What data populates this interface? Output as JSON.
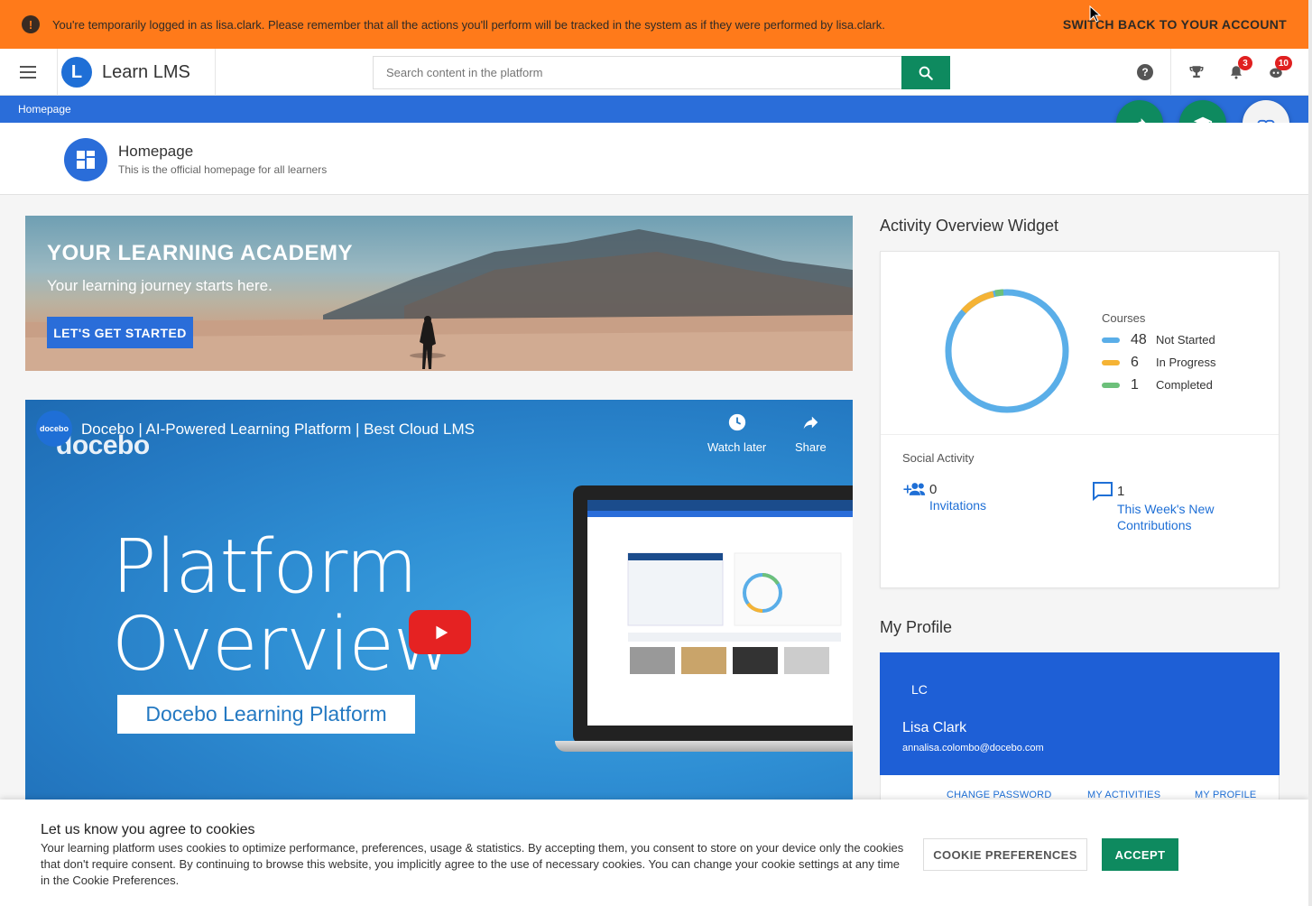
{
  "impersonation": {
    "message": "You're temporarily logged in as lisa.clark. Please remember that all the actions you'll perform will be tracked in the system as if they were performed by lisa.clark.",
    "switch_label": "SWITCH BACK TO YOUR ACCOUNT",
    "color": "#ff7a1a"
  },
  "header": {
    "logo_letter": "L",
    "logo_text": "Learn LMS",
    "search_placeholder": "Search content in the platform",
    "notifications_count": "3",
    "messages_count": "10"
  },
  "breadcrumb": {
    "current": "Homepage"
  },
  "page": {
    "title": "Homepage",
    "subtitle": "This is the official homepage for all learners"
  },
  "hero": {
    "title": "YOUR LEARNING ACADEMY",
    "subtitle": "Your learning journey starts here.",
    "cta": "LET'S GET STARTED"
  },
  "video": {
    "channel_avatar": "docebo",
    "title": "Docebo | AI-Powered Learning Platform | Best Cloud LMS",
    "brand": "docebo",
    "watch_later": "Watch later",
    "share": "Share",
    "headline_line1": "Platform",
    "headline_line2": "Overview",
    "subtitle": "Docebo Learning Platform"
  },
  "activity_widget": {
    "title": "Activity Overview Widget",
    "courses_label": "Courses",
    "items": [
      {
        "count": "48",
        "label": "Not Started",
        "color": "#5aaee8"
      },
      {
        "count": "6",
        "label": "In Progress",
        "color": "#f5b335"
      },
      {
        "count": "1",
        "label": "Completed",
        "color": "#6cc07a"
      }
    ],
    "social_title": "Social Activity",
    "invitations_count": "0",
    "invitations_label": "Invitations",
    "contributions_count": "1",
    "contributions_label_1": "This Week's New",
    "contributions_label_2": "Contributions"
  },
  "profile": {
    "section_title": "My Profile",
    "initials": "LC",
    "name": "Lisa Clark",
    "email": "annalisa.colombo@docebo.com",
    "links": [
      "CHANGE PASSWORD",
      "MY ACTIVITIES",
      "MY PROFILE"
    ]
  },
  "cookie": {
    "title": "Let us know you agree to cookies",
    "text": "Your learning platform uses cookies to optimize performance, preferences, usage & statistics. By accepting them, you consent to store on your device only the cookies that don't require consent. By continuing to browse this website, you implicitly agree to the use of necessary cookies. You can change your cookie settings at any time in the Cookie Preferences.",
    "preferences_label": "COOKIE PREFERENCES",
    "accept_label": "ACCEPT"
  }
}
